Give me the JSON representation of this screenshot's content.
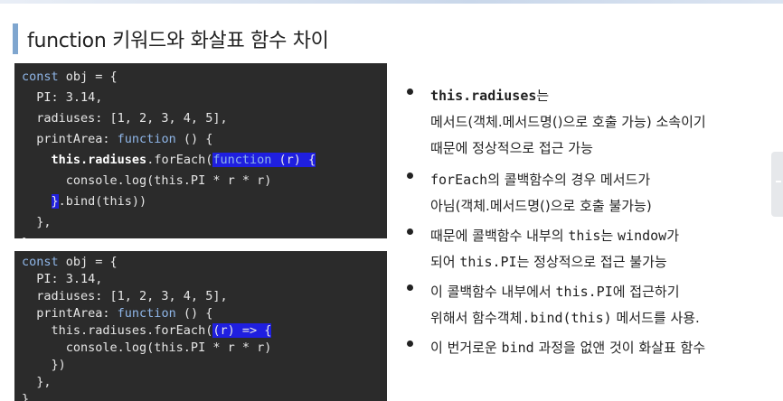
{
  "title": "function 키워드와 화살표 함수 차이",
  "code1": {
    "lines": [
      "const obj = {",
      "  PI: 3.14,",
      "  radiuses: [1, 2, 3, 4, 5],",
      "  printArea: function () {",
      "    this.radiuses.forEach(function (r) {",
      "      console.log(this.PI * r * r)",
      "    }.bind(this))",
      "  },",
      "}"
    ]
  },
  "code2": {
    "lines": [
      "const obj = {",
      "  PI: 3.14,",
      "  radiuses: [1, 2, 3, 4, 5],",
      "  printArea: function () {",
      "    this.radiuses.forEach((r) => {",
      "      console.log(this.PI * r * r)",
      "    })",
      "  },",
      "}"
    ]
  },
  "bullets": [
    {
      "l1_code": "this.radiuses",
      "l1_text": "는",
      "l2": "메서드(객체.메서드명()으로 호출 가능) 소속이기",
      "l3": "때문에 정상적으로 접근 가능"
    },
    {
      "l1_code": "forEach",
      "l1_text": "의 콜백함수의 경우 메서드가",
      "l2": "아님(객체.메서드명()으로 호출 불가능)"
    },
    {
      "l1_pre": "때문에 콜백함수 내부의 ",
      "l1_code1": "this",
      "l1_mid": "는 ",
      "l1_code2": "window",
      "l1_post": "가",
      "l2_pre": "되어 ",
      "l2_code": "this.PI",
      "l2_post": "는 정상적으로 접근 불가능"
    },
    {
      "l1_pre": "이 콜백함수 내부에서 ",
      "l1_code": "this.PI",
      "l1_post": "에 접근하기",
      "l2_pre": "위해서 함수객체",
      "l2_code": ".bind(this)",
      "l2_post": " 메서드를 사용."
    },
    {
      "l1_pre": "이 번거로운 ",
      "l1_code": "bind",
      "l1_post": " 과정을 없앤 것이 화살표 함수"
    }
  ]
}
